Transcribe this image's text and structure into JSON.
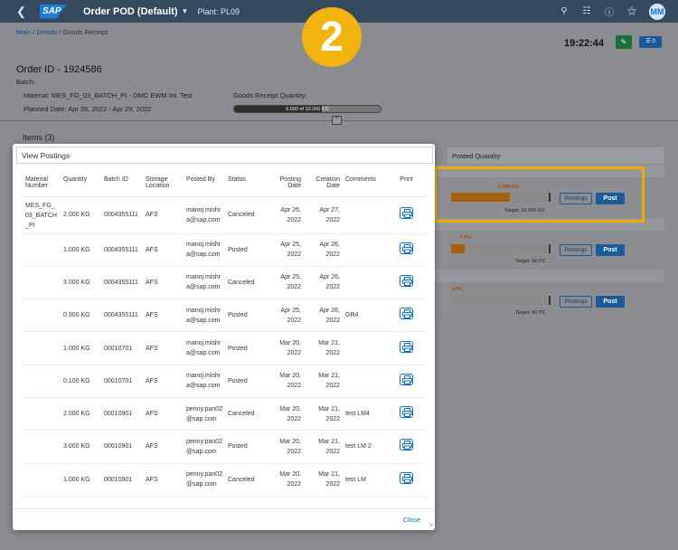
{
  "shell": {
    "back_icon": "chevron-left-icon",
    "logo": "SAP",
    "title": "Order POD (Default)",
    "title_caret": "▼",
    "plant": "Plant: PL09",
    "avatar": "MM"
  },
  "breadcrumb": {
    "main": "Main",
    "details": "Details",
    "current": "Goods Receipt",
    "separator": "/"
  },
  "header": {
    "clock": "19:22:44",
    "badge_count": "0",
    "order_id": "Order ID - 1924586",
    "batch": "Batch:",
    "material": "Material:  MES_FG_03_BATCH_PI - DMC EWM Int. Test",
    "planned": "Planned Date: Apr 26, 2022 - Apr 29, 2022",
    "gr_label": "Goods Receipt Quantity:",
    "gr_bar_text": "6.000 of 10.000 KG",
    "gr_progress": 0.6
  },
  "items_title": "Items (3)",
  "posted_quantity_header": "Posted Quantity",
  "posted_rows": [
    {
      "value": "6.000 KG",
      "target": "Target: 10.000 KG",
      "progress": 0.6
    },
    {
      "value": "7 PC",
      "target": "Target: 50 PC",
      "progress": 0.14
    },
    {
      "value": "6 PC",
      "target": "Target: 50 PC",
      "progress": 0.0
    }
  ],
  "buttons": {
    "postings": "Postings",
    "post": "Post"
  },
  "step_number": "2",
  "dialog": {
    "title": "View Postings",
    "close": "Close",
    "columns": [
      "Material Number",
      "Quantity",
      "Batch ID",
      "Storage Location",
      "Posted By",
      "Status",
      "Posting Date",
      "Creation Date",
      "Comments",
      "Print"
    ],
    "rows": [
      {
        "material": "MES_FG_03_BATCH_PI",
        "quantity": "2.000 KG",
        "batch": "0004355111",
        "storage": "AFS",
        "posted_by": "manoj.mishra@sap.com",
        "status": "Canceled",
        "posting_date": "Apr 26, 2022",
        "creation_date": "Apr 27, 2022",
        "comments": ""
      },
      {
        "material": "",
        "quantity": "1.000 KG",
        "batch": "0004355111",
        "storage": "AFS",
        "posted_by": "manoj.mishra@sap.com",
        "status": "Posted",
        "posting_date": "Apr 25, 2022",
        "creation_date": "Apr 26, 2022",
        "comments": ""
      },
      {
        "material": "",
        "quantity": "3.000 KG",
        "batch": "0004355111",
        "storage": "AFS",
        "posted_by": "manoj.mishra@sap.com",
        "status": "Canceled",
        "posting_date": "Apr 25, 2022",
        "creation_date": "Apr 26, 2022",
        "comments": ""
      },
      {
        "material": "",
        "quantity": "0.900 KG",
        "batch": "0004355111",
        "storage": "AFS",
        "posted_by": "manoj.mishra@sap.com",
        "status": "Posted",
        "posting_date": "Apr 25, 2022",
        "creation_date": "Apr 26, 2022",
        "comments": "GR4"
      },
      {
        "material": "",
        "quantity": "1.000 KG",
        "batch": "00010701",
        "storage": "AFS",
        "posted_by": "manoj.mishra@sap.com",
        "status": "Posted",
        "posting_date": "Mar 20, 2022",
        "creation_date": "Mar 21, 2022",
        "comments": ""
      },
      {
        "material": "",
        "quantity": "0.100 KG",
        "batch": "00010701",
        "storage": "AFS",
        "posted_by": "manoj.mishra@sap.com",
        "status": "Posted",
        "posting_date": "Mar 20, 2022",
        "creation_date": "Mar 21, 2022",
        "comments": ""
      },
      {
        "material": "",
        "quantity": "2.000 KG",
        "batch": "00010901",
        "storage": "AFS",
        "posted_by": "penny.pan02@sap.com",
        "status": "Canceled",
        "posting_date": "Mar 20, 2022",
        "creation_date": "Mar 21, 2022",
        "comments": "test LM4"
      },
      {
        "material": "",
        "quantity": "3.000 KG",
        "batch": "00010901",
        "storage": "AFS",
        "posted_by": "penny.pan02@sap.com",
        "status": "Posted",
        "posting_date": "Mar 20, 2022",
        "creation_date": "Mar 21, 2022",
        "comments": "test LM 2"
      },
      {
        "material": "",
        "quantity": "1.000 KG",
        "batch": "00010901",
        "storage": "AFS",
        "posted_by": "penny.pan02@sap.com",
        "status": "Canceled",
        "posting_date": "Mar 20, 2022",
        "creation_date": "Mar 21, 2022",
        "comments": "test LM"
      }
    ]
  },
  "colors": {
    "shell": "#354a5f",
    "accent": "#0a6ed1",
    "highlight": "#f0ab00",
    "progress": "#a65f0b"
  }
}
